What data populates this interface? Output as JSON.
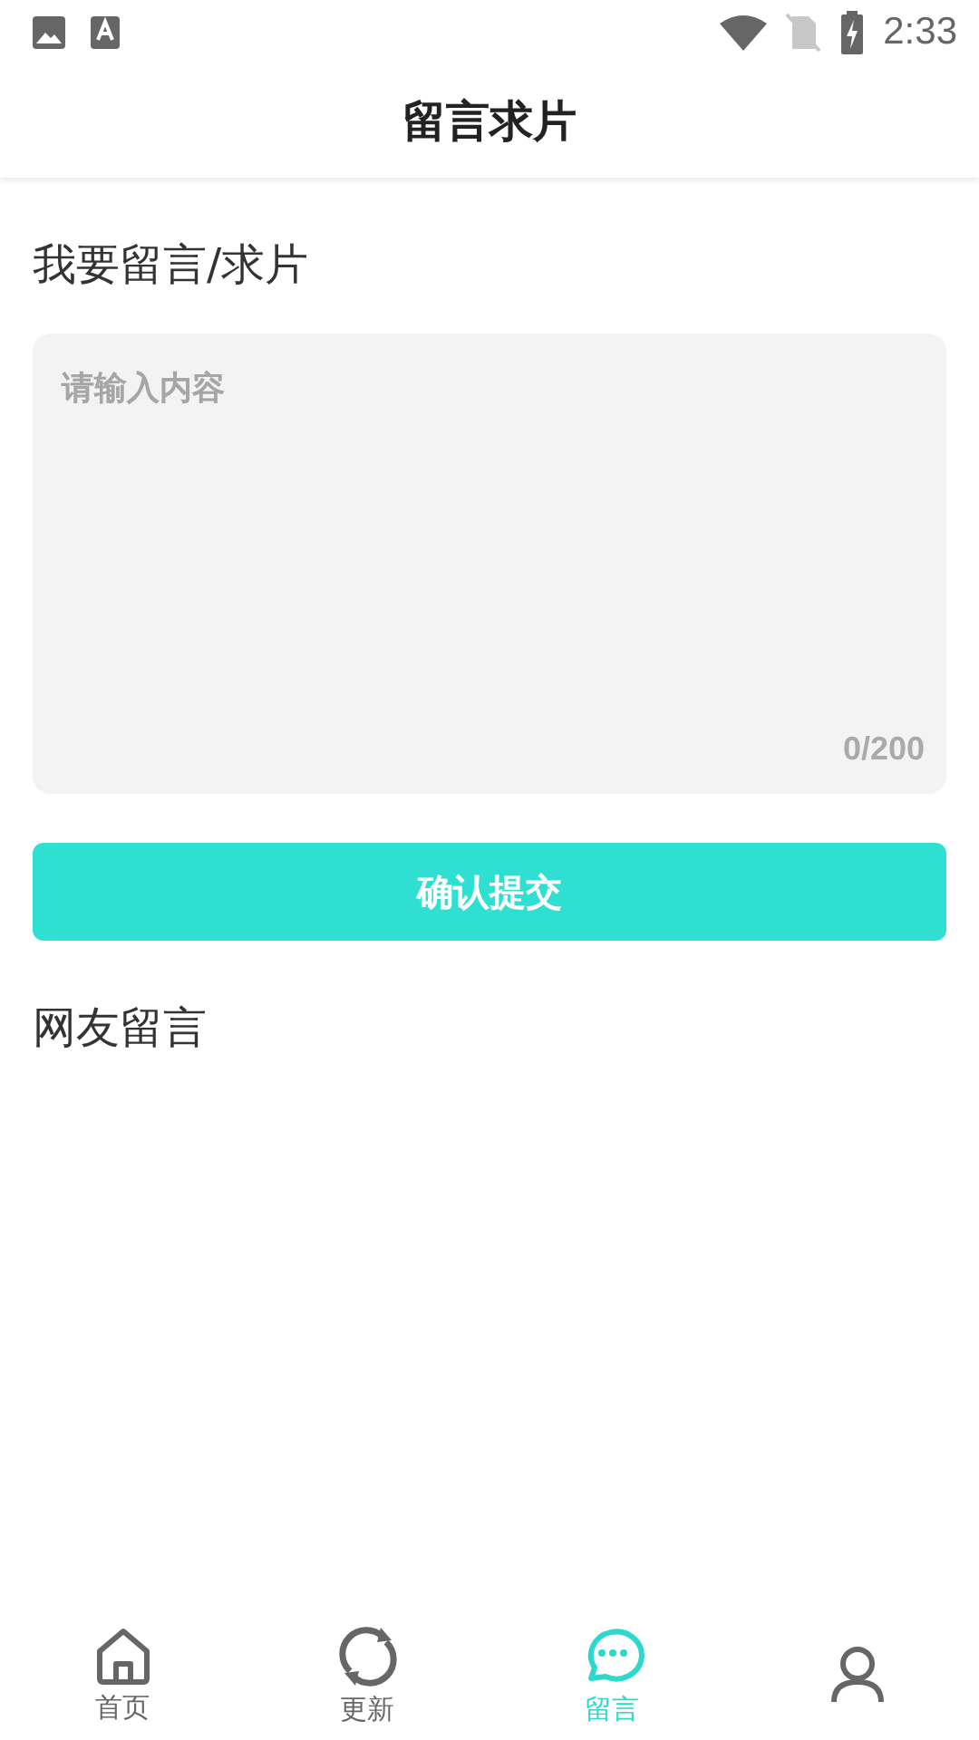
{
  "status_bar": {
    "time": "2:33"
  },
  "header": {
    "title": "留言求片"
  },
  "form": {
    "heading": "我要留言/求片",
    "placeholder": "请输入内容",
    "counter": "0/200",
    "submit": "确认提交"
  },
  "comments": {
    "heading": "网友留言"
  },
  "tab_bar": [
    {
      "kind": "home",
      "label": "首页",
      "selected": false
    },
    {
      "kind": "refresh",
      "label": "更新",
      "selected": false
    },
    {
      "kind": "message",
      "label": "留言",
      "selected": true
    },
    {
      "kind": "person",
      "selected": false
    }
  ]
}
